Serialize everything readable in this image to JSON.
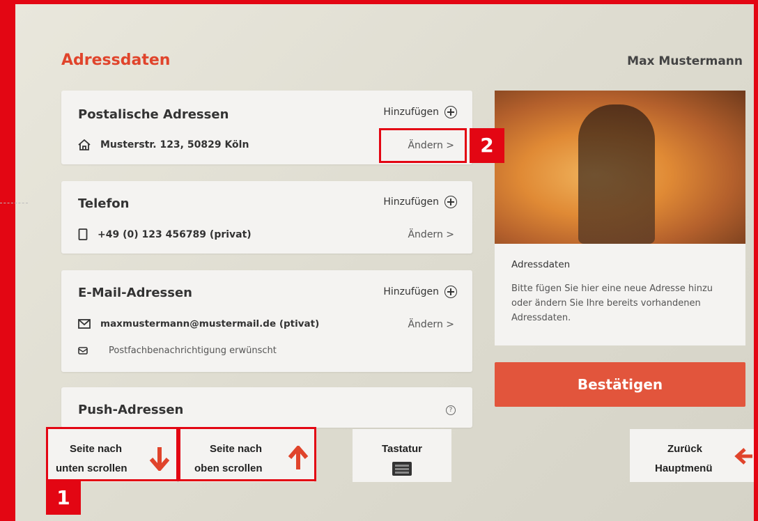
{
  "header": {
    "title": "Adressdaten",
    "user": "Max Mustermann"
  },
  "sections": [
    {
      "title": "Postalische Adressen",
      "add_label": "Hinzufügen",
      "value": "Musterstr. 123, 50829 Köln",
      "value_icon": "home-icon",
      "change_label": "Ändern  >"
    },
    {
      "title": "Telefon",
      "add_label": "Hinzufügen",
      "value": "+49 (0) 123 456789 (privat)",
      "value_icon": "phone-icon",
      "change_label": "Ändern  >"
    },
    {
      "title": "E-Mail-Adressen",
      "add_label": "Hinzufügen",
      "value": "maxmustermann@mustermail.de (ptivat)",
      "value_icon": "mail-icon",
      "change_label": "Ändern  >",
      "note": "Postfachbenachrichtigung erwünscht"
    },
    {
      "title": "Push-Adressen",
      "help_icon": "question-icon"
    }
  ],
  "info": {
    "title": "Adressdaten",
    "text": "Bitte fügen Sie hier eine neue Adresse hinzu oder ändern Sie Ihre bereits vorhandenen Adressdaten."
  },
  "confirm_label": "Bestätigen",
  "bottom_bar": {
    "scroll_down_line1": "Seite nach",
    "scroll_down_line2": "unten scrollen",
    "scroll_up_line1": "Seite nach",
    "scroll_up_line2": "oben scrollen",
    "keyboard_label": "Tastatur",
    "back_line1": "Zurück",
    "back_line2": "Hauptmenü"
  },
  "markers": {
    "one": "1",
    "two": "2"
  },
  "colors": {
    "brand_red": "#e30613",
    "accent": "#e2553c"
  }
}
